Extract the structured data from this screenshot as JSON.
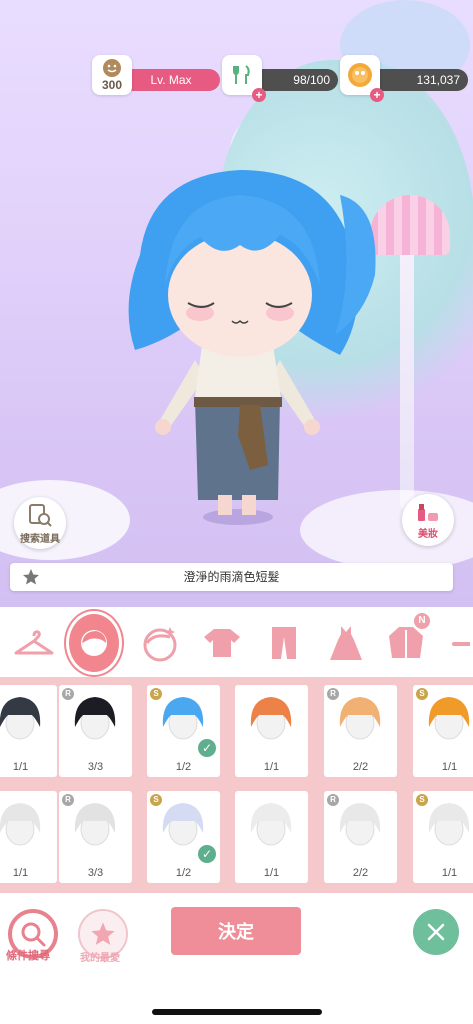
{
  "stats": {
    "level_value": "300",
    "level_label": "Lv. Max",
    "energy": "98/100",
    "coins": "131,037"
  },
  "side_buttons": {
    "search_item": "搜索道具",
    "makeup": "美妝"
  },
  "selected_item_name": "澄淨的雨滴色短髮",
  "categories": [
    {
      "name": "hanger-icon"
    },
    {
      "name": "hair-icon",
      "selected": true
    },
    {
      "name": "face-icon"
    },
    {
      "name": "top-icon"
    },
    {
      "name": "pants-icon"
    },
    {
      "name": "dress-icon"
    },
    {
      "name": "coat-icon",
      "new": "N"
    },
    {
      "name": "accessory-icon"
    }
  ],
  "items_row1": [
    {
      "badge": "",
      "count": "1/1",
      "hair": "#333a44"
    },
    {
      "badge": "R",
      "count": "3/3",
      "hair": "#1c1c24"
    },
    {
      "badge": "S",
      "count": "1/2",
      "hair": "#4aa8f0",
      "checked": true
    },
    {
      "badge": "",
      "count": "1/1",
      "hair": "#ec8247"
    },
    {
      "badge": "R",
      "count": "2/2",
      "hair": "#f0b172"
    },
    {
      "badge": "S",
      "count": "1/1",
      "hair": "#f09a2a"
    }
  ],
  "items_row2": [
    {
      "badge": "",
      "count": "1/1",
      "hair": "#e6e6e6"
    },
    {
      "badge": "R",
      "count": "3/3",
      "hair": "#e2e2e2"
    },
    {
      "badge": "S",
      "count": "1/2",
      "hair": "#d5dbf3",
      "checked": true
    },
    {
      "badge": "",
      "count": "1/1",
      "hair": "#ececec"
    },
    {
      "badge": "R",
      "count": "2/2",
      "hair": "#e8e8e8"
    },
    {
      "badge": "S",
      "count": "1/1",
      "hair": "#e9e9e9"
    }
  ],
  "bottom": {
    "filter_search": "條件搜尋",
    "my_favorites": "我的最愛",
    "confirm": "決定"
  },
  "colors": {
    "accent_pink": "#e75b82",
    "confirm_bg": "#ef8e98",
    "grid_bg": "#f5c9cc",
    "close_green": "#5fae8e"
  }
}
